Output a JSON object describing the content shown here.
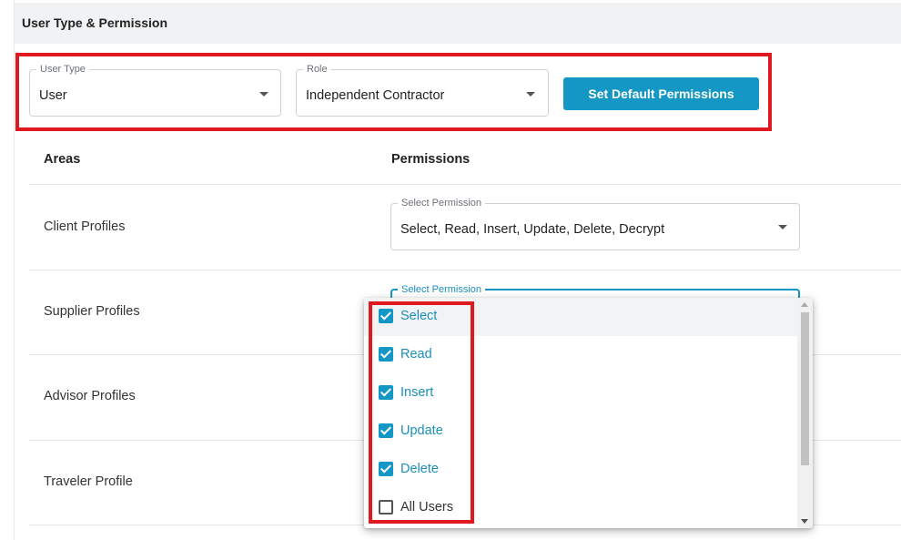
{
  "section": {
    "title": "User Type & Permission"
  },
  "user_type": {
    "label": "User Type",
    "value": "User"
  },
  "role": {
    "label": "Role",
    "value": "Independent Contractor"
  },
  "default_button": {
    "label": "Set Default Permissions"
  },
  "table": {
    "headers": {
      "areas": "Areas",
      "permissions": "Permissions"
    },
    "rows": [
      {
        "area": "Client Profiles",
        "select_label": "Select Permission",
        "value": "Select, Read, Insert, Update, Delete, Decrypt"
      },
      {
        "area": "Supplier Profiles",
        "select_label": "Select Permission"
      },
      {
        "area": "Advisor Profiles"
      },
      {
        "area": "Traveler Profile"
      }
    ]
  },
  "dropdown": {
    "options": [
      {
        "label": "Select",
        "checked": true
      },
      {
        "label": "Read",
        "checked": true
      },
      {
        "label": "Insert",
        "checked": true
      },
      {
        "label": "Update",
        "checked": true
      },
      {
        "label": "Delete",
        "checked": true
      },
      {
        "label": "All Users",
        "checked": false
      }
    ]
  },
  "colors": {
    "accent": "#1497c4",
    "highlight": "#e0181f"
  }
}
